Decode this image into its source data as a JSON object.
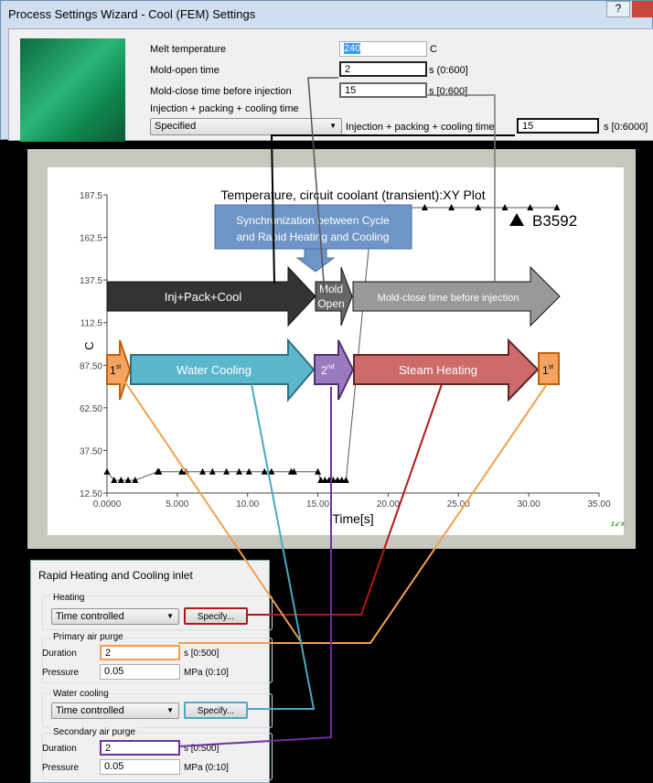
{
  "wizard": {
    "title": "Process Settings Wizard - Cool (FEM) Settings",
    "help": "?",
    "melt_label": "Melt temperature",
    "melt_value": "240",
    "melt_unit": "C",
    "open_label": "Mold-open time",
    "open_value": "2",
    "open_unit": "s (0:600]",
    "close_label": "Mold-close time before injection",
    "close_value": "15",
    "close_unit": "s [0:600]",
    "ipc_group": "Injection + packing + cooling time",
    "ipc_mode": "Specified",
    "ipc_label": "Injection + packing + cooling time",
    "ipc_value": "15",
    "ipc_unit": "s [0:6000]"
  },
  "chart_data": {
    "type": "scatter",
    "title": "Temperature, circuit coolant (transient):XY Plot",
    "xlabel": "Time[s]",
    "ylabel": "C",
    "xlim": [
      0,
      35
    ],
    "ylim": [
      12.5,
      187.5
    ],
    "xticks": [
      "0.0000",
      "5.000",
      "10.00",
      "15.00",
      "20.00",
      "25.00",
      "30.00",
      "35.00"
    ],
    "yticks": [
      "12.50",
      "37.50",
      "62.50",
      "87.50",
      "112.5",
      "137.5",
      "162.5",
      "187.5"
    ],
    "legend": "B3592",
    "legend_position": "top-right",
    "marker": "triangle",
    "series": [
      {
        "name": "B3592",
        "x": [
          0,
          0.5,
          1,
          1.5,
          2,
          3.6,
          3.7,
          5.3,
          5.6,
          6.8,
          7.5,
          8.5,
          9.4,
          10.1,
          11.2,
          11.7,
          13.1,
          13.3,
          15,
          15.2,
          15.5,
          15.8,
          16.1,
          16.4,
          16.7,
          17,
          18.9,
          20.7,
          22.6,
          24.5,
          26.4,
          28.3,
          30.1,
          32
        ],
        "y": [
          25,
          20,
          20,
          20,
          20,
          25,
          25,
          25,
          25,
          25,
          25,
          25,
          25,
          25,
          25,
          25,
          25,
          25,
          25,
          20,
          20,
          20,
          20,
          20,
          20,
          20,
          180,
          180,
          180,
          180,
          180,
          180,
          180,
          180
        ]
      }
    ]
  },
  "diagram": {
    "sync": "Synchronization between Cycle and Rapid Heating and Cooling",
    "sync_l1": "Synchronization between Cycle",
    "sync_l2": "and Rapid Heating and Cooling",
    "inj": "Inj+Pack+Cool",
    "open1": "Mold",
    "open2": "Open",
    "close": "Mold-close time before injection",
    "first": "1",
    "first_sup": "st",
    "water": "Water Cooling",
    "second": "2",
    "second_sup": "nd",
    "steam": "Steam Heating",
    "colors": {
      "inj": "#333333",
      "open": "#666666",
      "close": "#999999",
      "purge": "#f4a460",
      "water": "#5bb8cc",
      "second": "#9b7bbf",
      "steam": "#cd6a6a",
      "sync": "#6f95c7"
    }
  },
  "rhc": {
    "title": "Rapid Heating and Cooling inlet",
    "heating": "Heating",
    "heating_mode": "Time controlled",
    "specify": "Specify...",
    "primary": "Primary air purge",
    "duration": "Duration",
    "p_duration": "2",
    "dur_unit": "s [0:500]",
    "pressure": "Pressure",
    "p_pressure": "0.05",
    "pres_unit": "MPa (0:10]",
    "water": "Water cooling",
    "water_mode": "Time controlled",
    "secondary": "Secondary air purge",
    "s_duration": "2",
    "s_pressure": "0.05"
  }
}
